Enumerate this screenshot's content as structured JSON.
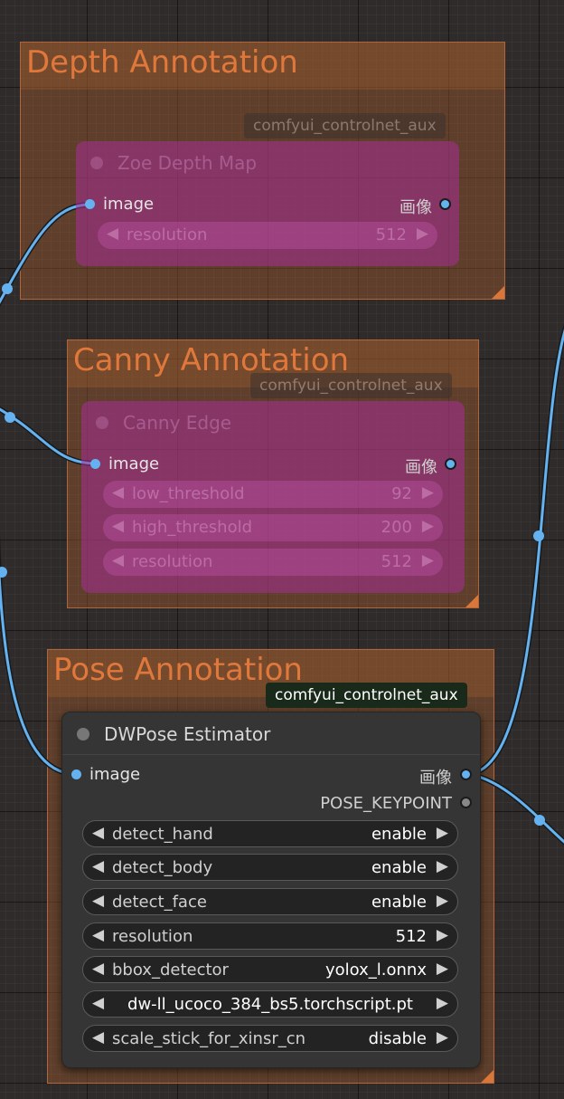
{
  "groups": {
    "depth": {
      "title": "Depth Annotation"
    },
    "canny": {
      "title": "Canny Annotation"
    },
    "pose": {
      "title": "Pose Annotation"
    }
  },
  "nodes": {
    "zoe_depth": {
      "badge": "comfyui_controlnet_aux",
      "title": "Zoe Depth Map",
      "input": "image",
      "output": "画像",
      "widgets": [
        {
          "label": "resolution",
          "value": "512"
        }
      ]
    },
    "canny_edge": {
      "badge": "comfyui_controlnet_aux",
      "title": "Canny Edge",
      "input": "image",
      "output": "画像",
      "widgets": [
        {
          "label": "low_threshold",
          "value": "92"
        },
        {
          "label": "high_threshold",
          "value": "200"
        },
        {
          "label": "resolution",
          "value": "512"
        }
      ]
    },
    "dwpose": {
      "badge": "comfyui_controlnet_aux",
      "title": "DWPose Estimator",
      "input": "image",
      "outputs": [
        "画像",
        "POSE_KEYPOINT"
      ],
      "widgets": [
        {
          "label": "detect_hand",
          "value": "enable"
        },
        {
          "label": "detect_body",
          "value": "enable"
        },
        {
          "label": "detect_face",
          "value": "enable"
        },
        {
          "label": "resolution",
          "value": "512"
        },
        {
          "label": "bbox_detector",
          "value": "yolox_l.onnx"
        },
        {
          "label": "",
          "value": "dw-ll_ucoco_384_bs5.torchscript.pt"
        },
        {
          "label": "scale_stick_for_xinsr_cn",
          "value": "disable"
        }
      ]
    }
  },
  "colors": {
    "wire": "#64b2f0",
    "group_title": "#e0783c",
    "muted_node": "#a52d96",
    "canvas": "#2e2b2a"
  },
  "icons": {
    "decrement": "left-triangle",
    "increment": "right-triangle",
    "slot": "circle"
  }
}
